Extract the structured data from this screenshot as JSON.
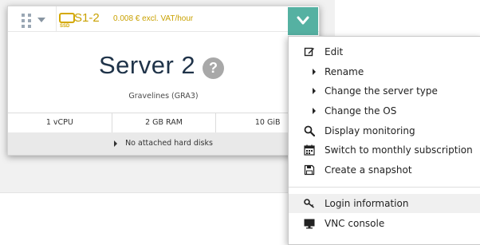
{
  "server": {
    "model": "S1-2",
    "disk_type_badge": "SSD",
    "price": "0.008 € excl. VAT/hour",
    "name": "Server 2",
    "help": "?",
    "location": "Gravelines (GRA3)",
    "specs": [
      "1 vCPU",
      "2 GB RAM",
      "10 GiB"
    ],
    "disks_text": "No attached hard disks"
  },
  "menu": {
    "items": [
      {
        "label": "Edit",
        "icon": "edit-icon"
      },
      {
        "label": "Rename",
        "icon": "caret-right-icon"
      },
      {
        "label": "Change the server type",
        "icon": "caret-right-icon"
      },
      {
        "label": "Change the OS",
        "icon": "caret-right-icon"
      },
      {
        "label": "Display monitoring",
        "icon": "search-icon"
      },
      {
        "label": "Switch to monthly subscription",
        "icon": "calendar-icon"
      },
      {
        "label": "Create a snapshot",
        "icon": "save-icon"
      },
      {
        "label": "Login information",
        "icon": "key-icon",
        "highlighted": true
      },
      {
        "label": "VNC console",
        "icon": "monitor-icon"
      }
    ]
  },
  "colors": {
    "accent_teal": "#55b1a2",
    "price_gold": "#c9a100",
    "title_navy": "#1f3349"
  }
}
